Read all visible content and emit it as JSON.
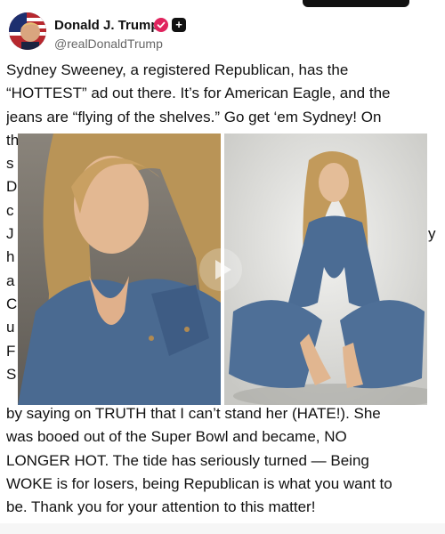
{
  "post": {
    "author_name": "Donald J. Trump",
    "handle": "@realDonaldTrump",
    "text_top": [
      "Sydney Sweeney, a registered Republican, has the",
      "“HOTTEST” ad out there. It’s for American Eagle, and the",
      "jeans are “flying of the shelves.” Go get ‘em Sydney! On"
    ],
    "text_obscured_left": [
      "th",
      "s",
      "D",
      "c",
      "J",
      "h",
      "a",
      "C",
      "u",
      "F",
      "S"
    ],
    "text_obscured_right": [
      "y"
    ],
    "text_bottom": [
      "by saying on TRUTH that I can’t stand her (HATE!). She",
      "was booed out of the Super Bowl and became, NO",
      "LONGER HOT. The tide has seriously turned — Being",
      "WOKE is for losers, being Republican is what you want to",
      "be. Thank you for your attention to this matter!"
    ]
  },
  "icons": {
    "verified": "verified-badge-icon",
    "plus": "plus-icon",
    "play": "play-icon"
  },
  "colors": {
    "verified_badge": "#e0245e",
    "text": "#111111",
    "handle": "#666666"
  }
}
